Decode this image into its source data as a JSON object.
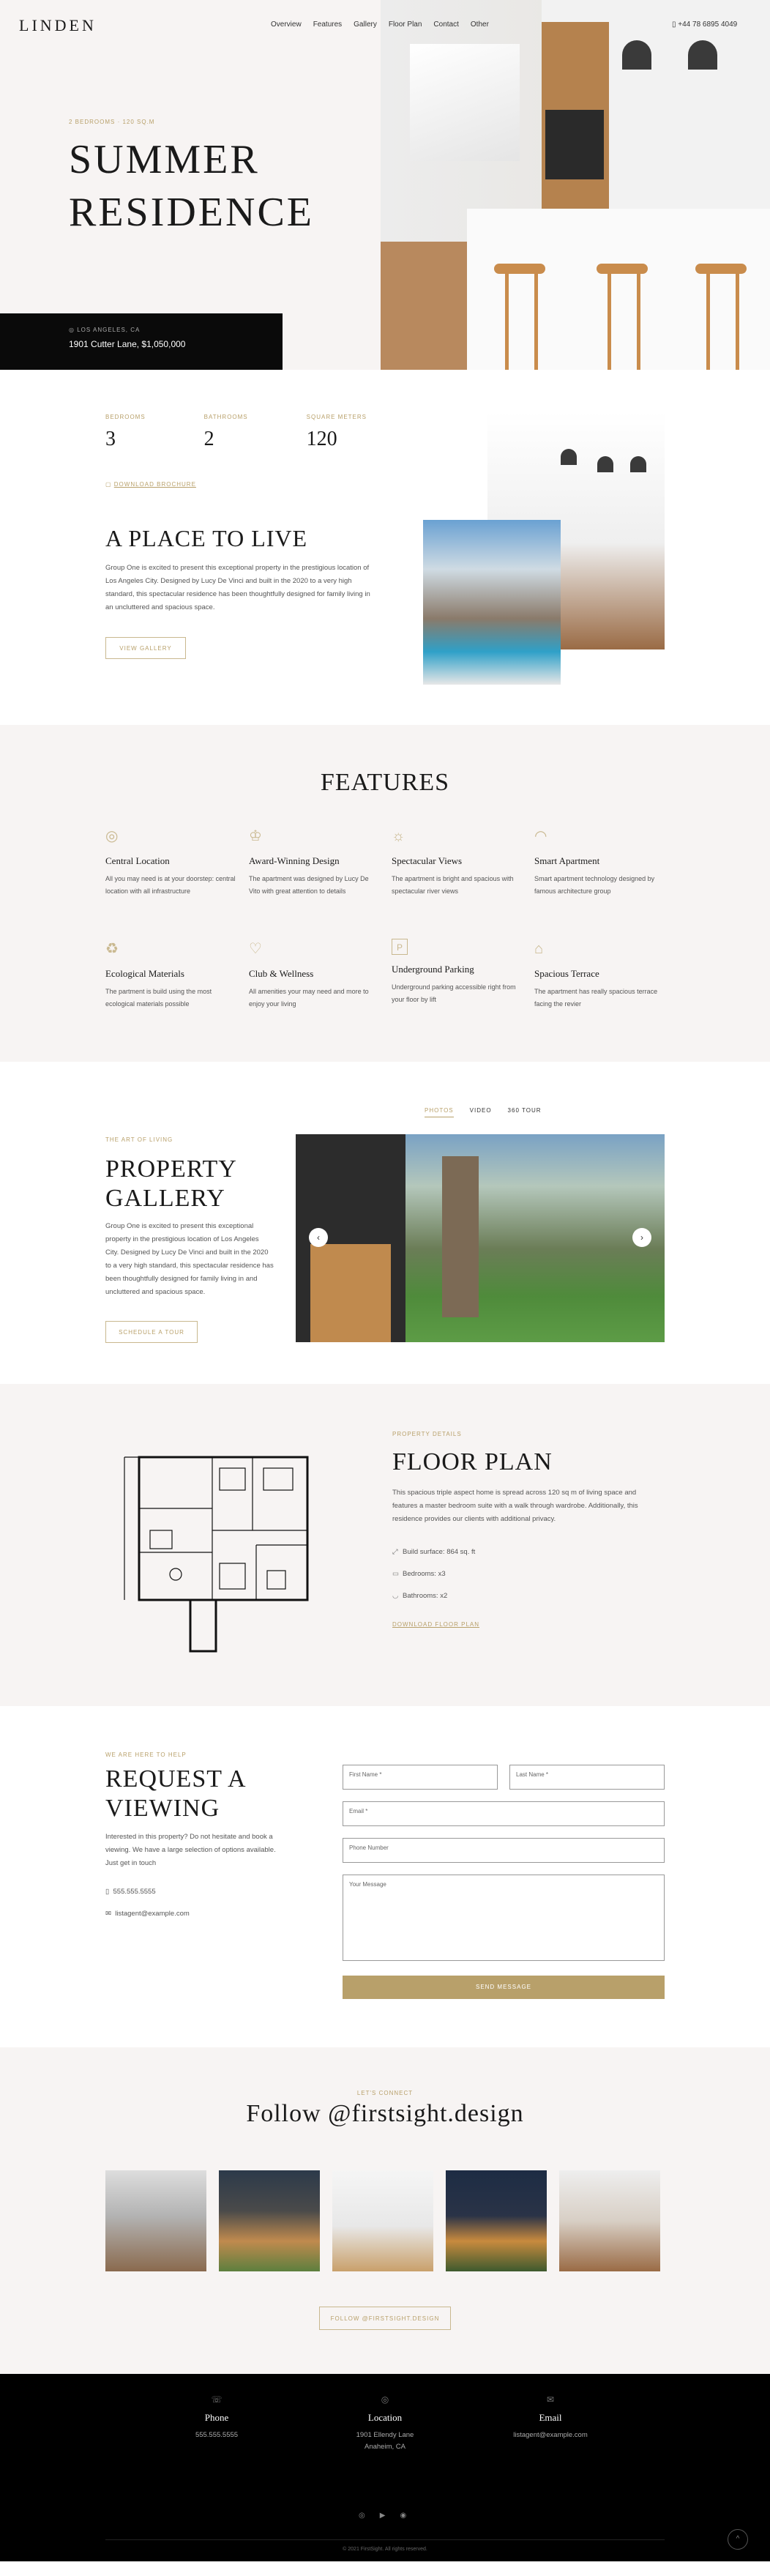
{
  "header": {
    "logo": "LINDEN",
    "menu": [
      "Overview",
      "Features",
      "Gallery",
      "Floor Plan",
      "Contact",
      "Other"
    ],
    "phone": "+44 78 6895 4049"
  },
  "hero": {
    "breadcrumb": "2 BEDROOMS · 120 SQ.M",
    "title_line1": "SUMMER",
    "title_line2": "RESIDENCE",
    "location": "LOS ANGELES, CA",
    "address_price": "1901 Cutter Lane, $1,050,000"
  },
  "place": {
    "stats": [
      {
        "label": "BEDROOMS",
        "value": "3"
      },
      {
        "label": "BATHROOMS",
        "value": "2"
      },
      {
        "label": "SQUARE METERS",
        "value": "120"
      }
    ],
    "download": "DOWNLOAD BROCHURE",
    "title": "A PLACE TO LIVE",
    "desc": "Group One is excited to present this exceptional property in the prestigious location of Los Angeles City. Designed by Lucy De Vinci and built in the 2020 to a very high standard, this spectacular residence has been thoughtfully designed for family living in an uncluttered and spacious space.",
    "button": "VIEW GALLERY"
  },
  "features": {
    "title": "FEATURES",
    "items": [
      {
        "icon": "pin-icon",
        "glyph": "◎",
        "title": "Central Location",
        "desc": "All you may need is at your doorstep: central location with all infrastructure"
      },
      {
        "icon": "award-icon",
        "glyph": "♔",
        "title": "Award-Winning Design",
        "desc": "The apartment was designed by Lucy De Vito with great attention to details"
      },
      {
        "icon": "sun-icon",
        "glyph": "☼",
        "title": "Spectacular Views",
        "desc": "The apartment is bright and spacious with spectacular river views"
      },
      {
        "icon": "wifi-icon",
        "glyph": "◠",
        "title": "Smart Apartment",
        "desc": "Smart apartment technology designed by famous architecture group"
      },
      {
        "icon": "recycle-icon",
        "glyph": "♻",
        "title": "Ecological Materials",
        "desc": "The partment is build using the most ecological materials possible"
      },
      {
        "icon": "heart-icon",
        "glyph": "♡",
        "title": "Club & Wellness",
        "desc": "All amenities your may need and more to enjoy your living"
      },
      {
        "icon": "parking-icon",
        "glyph": "P",
        "title": "Underground Parking",
        "desc": "Underground parking accessible right from your floor by lift"
      },
      {
        "icon": "terrace-icon",
        "glyph": "⌂",
        "title": "Spacious Terrace",
        "desc": "The apartment has really spacious terrace facing the revier"
      }
    ]
  },
  "gallery": {
    "tabs": [
      "PHOTOS",
      "VIDEO",
      "360 TOUR"
    ],
    "eyebrow": "THE ART OF LIVING",
    "title_line1": "PROPERTY",
    "title_line2": "GALLERY",
    "desc": "Group One is excited to present this exceptional property in the prestigious location of Los Angeles City. Designed by Lucy De Vinci and built in the 2020 to a very high standard, this spectacular residence has been thoughtfully designed for family living in and uncluttered and spacious space.",
    "button": "SCHEDULE A TOUR",
    "prev": "‹",
    "next": "›"
  },
  "floor": {
    "eyebrow": "PROPERTY DETAILS",
    "title": "FLOOR PLAN",
    "desc": "This spacious triple aspect home is spread across 120 sq m of living space and features a master bedroom suite with a walk through wardrobe. Additionally, this residence provides our clients with additional privacy.",
    "items": [
      "Build surface: 864 sq. ft",
      "Bedrooms: x3",
      "Bathrooms: x2"
    ],
    "download": "DOWNLOAD FLOOR PLAN"
  },
  "request": {
    "eyebrow": "WE ARE HERE TO HELP",
    "title_line1": "REQUEST A",
    "title_line2": "VIEWING",
    "desc": "Interested in this property? Do not hesitate and book a viewing. We have a large selection of options available. Just get in touch",
    "phone": "555.555.5555",
    "email": "listagent@example.com",
    "fields": {
      "first": "First Name *",
      "last": "Last Name *",
      "email": "Email *",
      "phone": "Phone Number",
      "message": "Your Message"
    },
    "send": "SEND MESSAGE"
  },
  "follow": {
    "eyebrow": "LET'S CONNECT",
    "title": "Follow @firstsight.design",
    "button": "FOLLOW @FIRSTSIGHT.DESIGN"
  },
  "footer": {
    "cols": [
      {
        "icon": "phone-icon",
        "glyph": "☏",
        "title": "Phone",
        "v1": "555.555.5555",
        "v2": ""
      },
      {
        "icon": "location-icon",
        "glyph": "◎",
        "title": "Location",
        "v1": "1901 Ellendy Lane",
        "v2": "Anaheim, CA"
      },
      {
        "icon": "mail-icon",
        "glyph": "✉",
        "title": "Email",
        "v1": "listagent@example.com",
        "v2": ""
      }
    ],
    "social": [
      "◎",
      "▶",
      "◉"
    ],
    "copyright": "© 2021 FirstSight. All rights reserved.",
    "totop": "^"
  }
}
